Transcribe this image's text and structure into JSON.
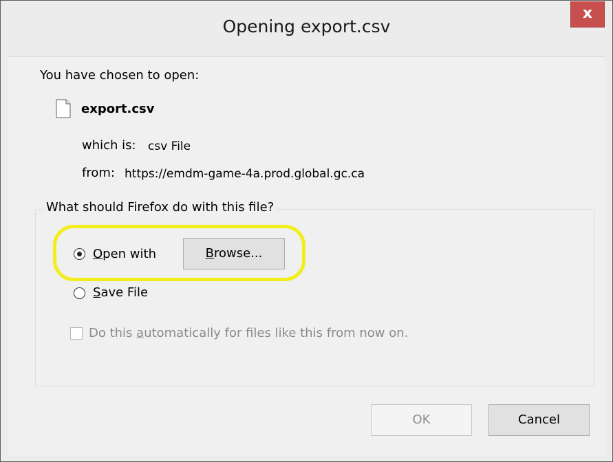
{
  "window": {
    "title": "Opening export.csv",
    "close_label": "x"
  },
  "intro_text": "You have chosen to open:",
  "file": {
    "icon": "file-icon",
    "name": "export.csv",
    "type_label": "which is:",
    "type_value": "csv File",
    "from_label": "from:",
    "from_value": "https://emdm-game-4a.prod.global.gc.ca"
  },
  "action_group": {
    "legend": "What should Firefox do with this file?",
    "open_with": {
      "label_first": "O",
      "label_rest": "pen with",
      "selected": true
    },
    "browse_button": {
      "label_first": "B",
      "label_rest": "rowse..."
    },
    "save_file": {
      "label_first": "S",
      "label_rest": "ave File",
      "selected": false
    },
    "auto_checkbox": {
      "label_before": "Do this ",
      "label_accel": "a",
      "label_after": "utomatically for files like this from now on.",
      "checked": false,
      "enabled": false
    },
    "highlight_color": "#f2ee1b"
  },
  "buttons": {
    "ok": "OK",
    "cancel": "Cancel"
  },
  "colors": {
    "close_button": "#c7504f",
    "dialog_bg": "#f0f0f0"
  }
}
